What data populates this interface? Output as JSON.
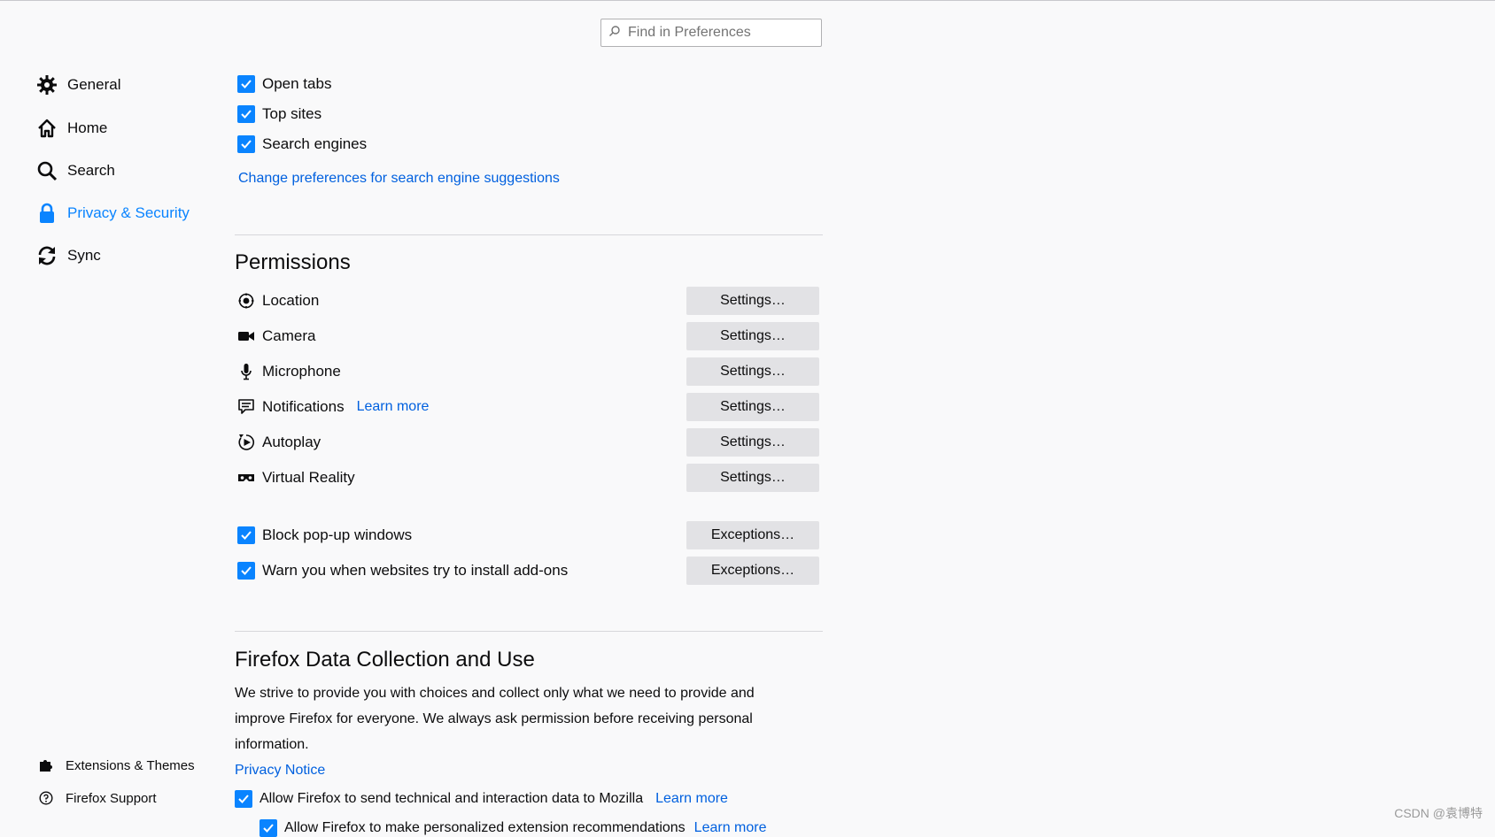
{
  "search": {
    "placeholder": "Find in Preferences"
  },
  "sidebar": {
    "items": [
      {
        "label": "General",
        "icon": "gear-icon"
      },
      {
        "label": "Home",
        "icon": "home-icon"
      },
      {
        "label": "Search",
        "icon": "search-icon"
      },
      {
        "label": "Privacy & Security",
        "icon": "lock-icon",
        "selected": true
      },
      {
        "label": "Sync",
        "icon": "sync-icon"
      }
    ],
    "footer": [
      {
        "label": "Extensions & Themes",
        "icon": "puzzle-icon"
      },
      {
        "label": "Firefox Support",
        "icon": "help-icon"
      }
    ]
  },
  "address_bar": {
    "options": [
      {
        "label": "Open tabs",
        "checked": true
      },
      {
        "label": "Top sites",
        "checked": true
      },
      {
        "label": "Search engines",
        "checked": true
      }
    ],
    "link": "Change preferences for search engine suggestions"
  },
  "permissions": {
    "title": "Permissions",
    "items": [
      {
        "label": "Location",
        "icon": "location-icon",
        "button": "Settings…"
      },
      {
        "label": "Camera",
        "icon": "camera-icon",
        "button": "Settings…"
      },
      {
        "label": "Microphone",
        "icon": "microphone-icon",
        "button": "Settings…"
      },
      {
        "label": "Notifications",
        "icon": "notification-icon",
        "button": "Settings…",
        "link": "Learn more"
      },
      {
        "label": "Autoplay",
        "icon": "autoplay-icon",
        "button": "Settings…"
      },
      {
        "label": "Virtual Reality",
        "icon": "vr-icon",
        "button": "Settings…"
      }
    ],
    "checks": [
      {
        "label": "Block pop-up windows",
        "checked": true,
        "button": "Exceptions…"
      },
      {
        "label": "Warn you when websites try to install add-ons",
        "checked": true,
        "button": "Exceptions…"
      }
    ]
  },
  "data_collection": {
    "title": "Firefox Data Collection and Use",
    "description": "We strive to provide you with choices and collect only what we need to provide and improve Firefox for everyone. We always ask permission before receiving personal information.",
    "privacy_link": "Privacy Notice",
    "options": [
      {
        "label": "Allow Firefox to send technical and interaction data to Mozilla",
        "checked": true,
        "link": "Learn more"
      },
      {
        "label": "Allow Firefox to make personalized extension recommendations",
        "checked": true,
        "link": "Learn more"
      }
    ]
  },
  "watermark": "CSDN @袁博特",
  "colors": {
    "accent": "#0a84ff",
    "link": "#0060df",
    "button_bg": "#e2e2e5",
    "background": "#f9f9fa"
  }
}
